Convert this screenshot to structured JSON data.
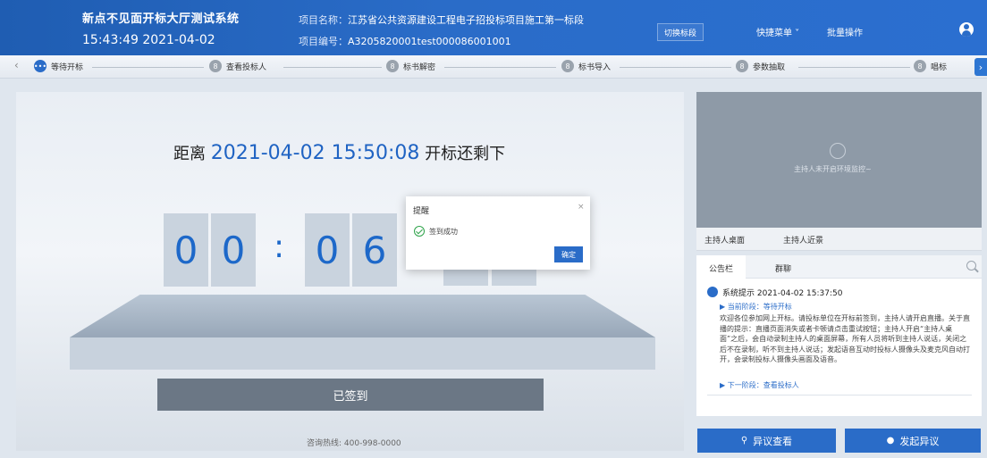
{
  "header": {
    "system_title": "新点不见面开标大厅测试系统",
    "time": "15:43:49 2021-04-02",
    "project_name_label": "项目名称：",
    "project_name": "江苏省公共资源建设工程电子招投标项目施工第一标段",
    "project_code_label": "项目编号：",
    "project_code": "A3205820001test000086001001",
    "switch_section": "切换标段",
    "quick_menu": "快捷菜单 ˅",
    "batch_operation": "批量操作"
  },
  "stages": [
    {
      "label": "等待开标",
      "icon": "•••",
      "active": true
    },
    {
      "label": "查看投标人",
      "icon": "8"
    },
    {
      "label": "标书解密",
      "icon": "8"
    },
    {
      "label": "标书导入",
      "icon": "8"
    },
    {
      "label": "参数抽取",
      "icon": "8"
    },
    {
      "label": "唱标",
      "icon": "8"
    }
  ],
  "countdown": {
    "prefix": "距离",
    "datetime": "2021-04-02 15:50:08",
    "suffix": "开标还剩下",
    "digits": [
      "0",
      "0",
      "0",
      "6"
    ],
    "colon": ":"
  },
  "signed_button": "已签到",
  "hotline": "咨询热线: 400-998-0000",
  "dialog": {
    "title": "提醒",
    "close": "×",
    "message": "签到成功",
    "confirm": "确定"
  },
  "video": {
    "placeholder": "主持人未开启环境监控~"
  },
  "host_tabs": [
    "主持人桌面",
    "主持人近景"
  ],
  "notice": {
    "tabs": [
      "公告栏",
      "群聊"
    ],
    "message_title": "系统提示 2021-04-02 15:37:50",
    "current_stage": "▶ 当前阶段：等待开标",
    "body": "欢迎各位参加网上开标。请投标单位在开标前签到，主持人请开启直播。关于直播的提示：直播页面消失或者卡顿请点击重试按钮；主持人开启“主持人桌面”之后，会自动录制主持人的桌面屏幕，所有人员将听到主持人说话，关闭之后不在录制，听不到主持人说话；发起语音互动时投标人摄像头及麦克风自动打开，会录制投标人摄像头画面及语音。",
    "next_stage": "▶ 下一阶段：查看投标人"
  },
  "buttons": {
    "view_objection": "异议查看",
    "raise_objection": "发起异议"
  }
}
